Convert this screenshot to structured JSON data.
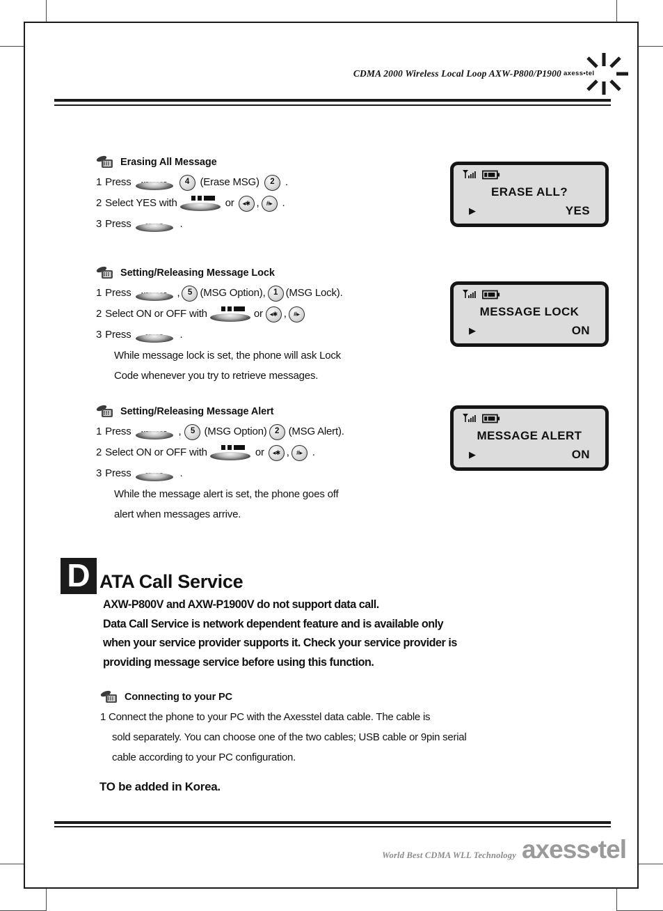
{
  "header": {
    "title": "CDMA 2000 Wireless Local Loop AXW-P800/P1900",
    "logo_text": "axess•tel"
  },
  "footer": {
    "tagline": "World Best CDMA WLL  Technology",
    "logo": "axess•tel"
  },
  "sections": [
    {
      "title": "Erasing All Message",
      "steps": [
        {
          "num": "1",
          "pre": "Press",
          "keys": [
            "MESSAGE",
            "4"
          ],
          "mid": "(Erase MSG)",
          "post": "2",
          "end": "."
        },
        {
          "num": "2",
          "pre": "Select YES with",
          "or": "or",
          "end": "."
        },
        {
          "num": "3",
          "pre": "Press",
          "key": "STORE",
          "end": "."
        }
      ]
    },
    {
      "title": "Setting/Releasing Message Lock",
      "steps": [
        {
          "num": "1",
          "pre": "Press",
          "k1": "MESSAGE",
          "c1": ",",
          "n1": "5",
          "t1": "(MSG Option),",
          "n2": "1",
          "t2": "(MSG Lock)."
        },
        {
          "num": "2",
          "pre": "Select ON or OFF with",
          "or": "or",
          "end": ""
        },
        {
          "num": "3",
          "pre": "Press",
          "key": "STORE",
          "end": "."
        }
      ],
      "notes": [
        "While message lock is set, the phone will ask Lock",
        "Code whenever you try to retrieve messages."
      ]
    },
    {
      "title": "Setting/Releasing Message Alert",
      "steps": [
        {
          "num": "1",
          "pre": "Press",
          "k1": "MESSAGE",
          "c1": ",",
          "n1": "5",
          "t1": "(MSG Option)",
          "n2": "2",
          "t2": "(MSG Alert)."
        },
        {
          "num": "2",
          "pre": "Select ON or OFF with",
          "or": "or",
          "end": "."
        },
        {
          "num": "3",
          "pre": "Press",
          "key": "STORE",
          "end": "."
        }
      ],
      "notes": [
        "While the message alert is set, the phone goes off",
        "alert when messages arrive."
      ]
    }
  ],
  "lcds": [
    {
      "line1": "ERASE   ALL?",
      "arrow": "▶",
      "value": "YES"
    },
    {
      "line1": "MESSAGE LOCK",
      "arrow": "▶",
      "value": "ON"
    },
    {
      "line1": "MESSAGE ALERT",
      "arrow": "▶",
      "value": "ON"
    }
  ],
  "data_call": {
    "drop_cap": "D",
    "heading_rest": "ATA Call Service",
    "lede_lines": [
      "AXW-P800V and AXW-P1900V do not support data call.",
      "Data Call Service is network dependent feature and is available only",
      "when your service provider supports it.  Check your service provider is",
      "providing message service before using this function."
    ],
    "pc_section_title": "Connecting to your PC",
    "pc_lines": [
      "1 Connect the phone to your PC with the Axesstel data cable.  The cable is",
      "sold separately. You can choose one of the two cables; USB cable or 9pin serial",
      "cable according to your PC configuration."
    ],
    "korea_note": "TO be added in Korea."
  },
  "key_labels": {
    "message": "MESSAGE",
    "store": "STORE",
    "star": "◂✱",
    "hash": "#▸"
  },
  "colors": {
    "ink": "#111111",
    "lcd_bg": "#dcdcdc",
    "lcd_frame": "#151515",
    "footer_gray": "#9a9a9a"
  }
}
